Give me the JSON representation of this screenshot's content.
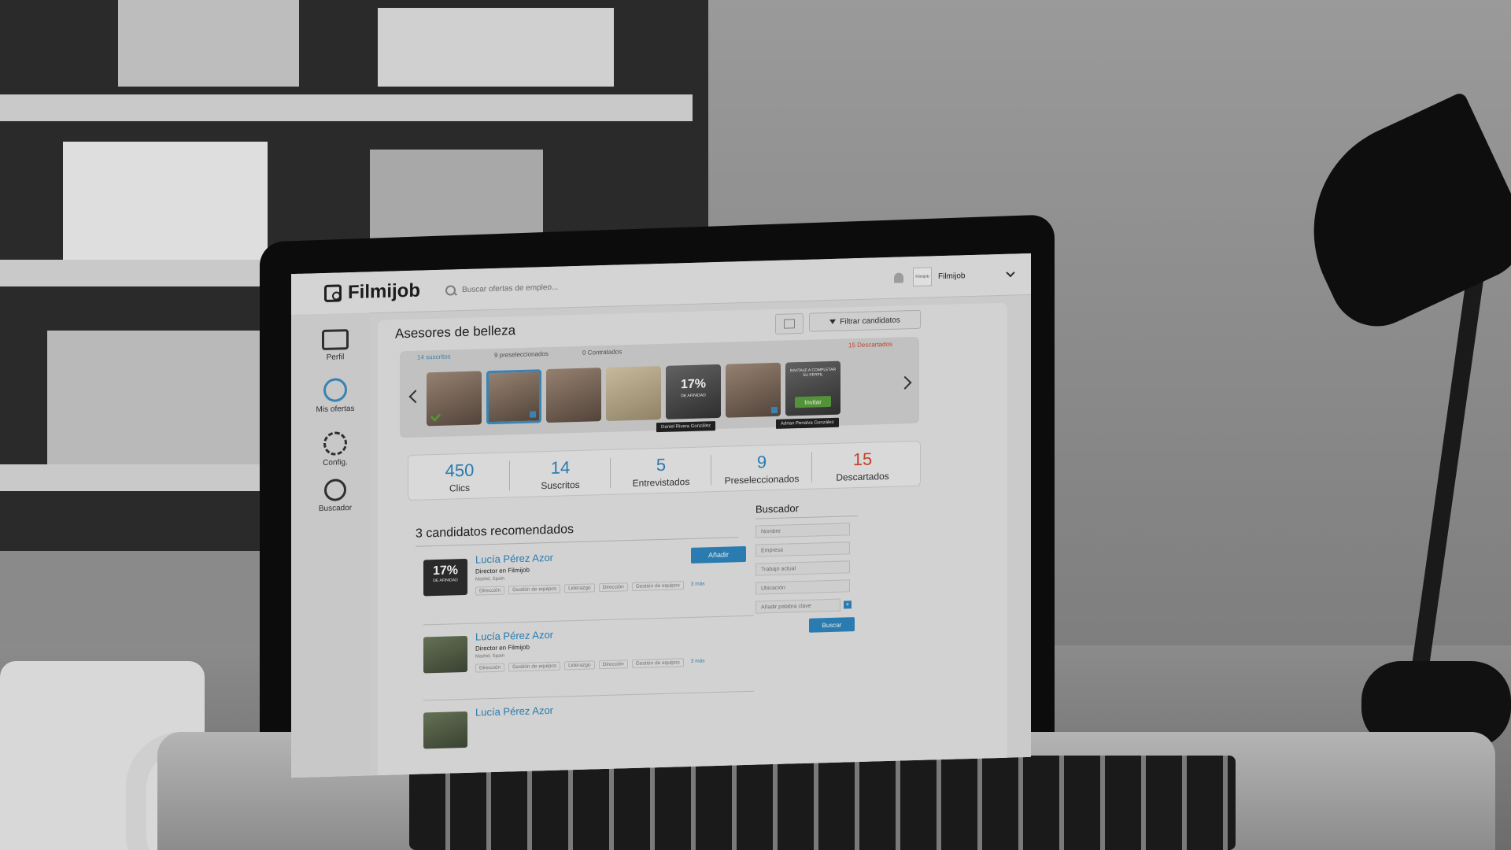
{
  "app": {
    "logo_text": "Filmijob",
    "search_placeholder": "Buscar ofertas de empleo...",
    "company_logo_text": "Filmijob",
    "company_name": "Filmijob"
  },
  "sidebar": {
    "items": [
      {
        "label": "Perfil",
        "icon": "profile-card-icon"
      },
      {
        "label": "Mis ofertas",
        "icon": "edit-users-icon",
        "active": true
      },
      {
        "label": "Config.",
        "icon": "gear-icon"
      },
      {
        "label": "Buscador",
        "icon": "search-icon"
      }
    ]
  },
  "offer": {
    "title": "Asesores de belleza",
    "filter_label": "Filtrar candidatos"
  },
  "tabs": {
    "suscritos": "14 suscritos",
    "preseleccionados": "9 preseleccionados",
    "contratados": "0 Contratados",
    "descartados": "15 Descartados"
  },
  "avatars": {
    "affinity_percent": "17%",
    "affinity_label": "DE AFINIDAD",
    "invite_text": "INVITALE A COMPLETAR SU PERFIL",
    "invite_button": "Invitar",
    "tooltip_1": "Daniel Rivera González",
    "tooltip_2": "Adrian Penalva González"
  },
  "stats": [
    {
      "value": "450",
      "label": "Clics"
    },
    {
      "value": "14",
      "label": "Suscritos"
    },
    {
      "value": "5",
      "label": "Entrevistados"
    },
    {
      "value": "9",
      "label": "Preseleccionados"
    },
    {
      "value": "15",
      "label": "Descartados"
    }
  ],
  "recommended": {
    "title": "3 candidatos recomendados",
    "add_label": "Añadir",
    "items": [
      {
        "percent": "17%",
        "affinity": "DE AFINIDAD",
        "name": "Lucía Pérez Azor",
        "role": "Director en Filmijob",
        "location": "Madrid, Spain",
        "tags": [
          "Dirección",
          "Gestión de equipos",
          "Liderazgo",
          "Dirección",
          "Gestión de equipos"
        ],
        "more": "3 más"
      },
      {
        "name": "Lucía Pérez Azor",
        "role": "Director en Filmijob",
        "location": "Madrid, Spain",
        "tags": [
          "Dirección",
          "Gestión de equipos",
          "Liderazgo",
          "Dirección",
          "Gestión de equipos"
        ],
        "more": "3 más"
      },
      {
        "name": "Lucía Pérez Azor"
      }
    ]
  },
  "buscador": {
    "title": "Buscador",
    "nombre": "Nombre",
    "empresa": "Empresa",
    "trabajo": "Trabajo actual",
    "ubicacion": "Ubicación",
    "keyword": "Añadir palabra clave",
    "plus": "+",
    "button": "Buscar"
  },
  "colors": {
    "accent": "#2e86be",
    "discard": "#d04a2f",
    "invite": "#5aa03e"
  }
}
